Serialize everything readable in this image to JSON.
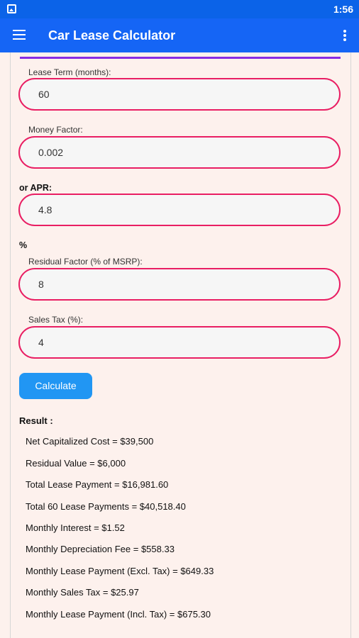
{
  "status_bar": {
    "time": "1:56",
    "icons": [
      "image-icon"
    ]
  },
  "app_bar": {
    "title": "Car Lease Calculator",
    "left_icon": "menu-icon",
    "right_icon": "more-vert-icon"
  },
  "form": {
    "lease_term_label": "Lease Term (months):",
    "lease_term_value": "60",
    "money_factor_label": "Money Factor:",
    "money_factor_value": "0.002",
    "apr_label": "or APR:",
    "apr_value": "4.8",
    "percent_label": "%",
    "residual_label": "Residual Factor (% of MSRP):",
    "residual_value": "8",
    "sales_tax_label": "Sales Tax (%):",
    "sales_tax_value": "4",
    "calculate_label": "Calculate"
  },
  "result": {
    "title": "Result :",
    "lines": [
      "Net Capitalized Cost = $39,500",
      "Residual Value = $6,000",
      "Total Lease Payment = $16,981.60",
      "Total 60 Lease Payments = $40,518.40",
      "Monthly Interest = $1.52",
      "Monthly Depreciation Fee = $558.33",
      "Monthly Lease Payment (Excl. Tax) = $649.33",
      "Monthly Sales Tax = $25.97",
      "Monthly Lease Payment (Incl. Tax) = $675.30"
    ]
  },
  "colors": {
    "status_bar": "#0b63e8",
    "app_bar": "#1565f5",
    "field_border": "#e91e63",
    "button": "#2196f3",
    "accent_line": "#8a2be2",
    "background": "#fdf1ed"
  }
}
